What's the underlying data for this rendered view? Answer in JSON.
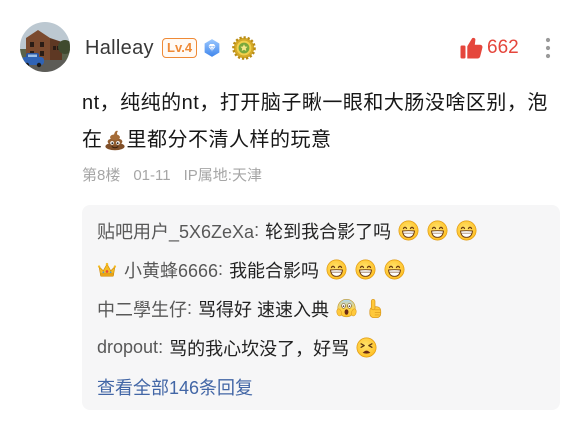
{
  "post": {
    "author": {
      "name": "Halleay",
      "level": "Lv.4",
      "badge_icons": [
        "diamond-badge-icon",
        "medal-badge-icon"
      ]
    },
    "likes": {
      "icon": "thumbs-up-icon",
      "count": "662"
    },
    "more_icon": "more-vertical-icon",
    "content": {
      "line1": "nt，纯纯的nt，打开脑子瞅一眼和大肠没啥区别，泡",
      "line2_before_emoji": "在",
      "line2_emoji": "pile-of-poo-icon",
      "line2_after_emoji": "里都分不清人样的玩意"
    },
    "meta": {
      "floor": "第8楼",
      "date": "01-11",
      "ip_location": "IP属地:天津"
    }
  },
  "replies": {
    "separator": ":",
    "items": [
      {
        "user": "贴吧用户_5X6ZeXa",
        "text": "轮到我合影了吗",
        "emojis": [
          "grinning-face-icon",
          "grinning-face-icon",
          "grinning-face-icon"
        ]
      },
      {
        "user_badge_icon": "crown-icon",
        "user": "小黄蜂6666",
        "text": "我能合影吗",
        "emojis": [
          "grinning-face-icon",
          "grinning-face-icon",
          "grinning-face-icon"
        ]
      },
      {
        "user": "中二學生仔",
        "text": "骂得好 速速入典",
        "emojis": [
          "face-screaming-in-fear-icon",
          "backhand-index-pointing-up-icon"
        ]
      },
      {
        "user": "dropout",
        "text": "骂的我心坎没了，好骂",
        "emojis": [
          "tired-face-icon"
        ]
      }
    ],
    "view_all": "查看全部146条回复"
  },
  "colors": {
    "like": "#e5463c",
    "link": "#4266a6",
    "level": "#ef8a36",
    "reply_background": "#f6f6f7"
  }
}
